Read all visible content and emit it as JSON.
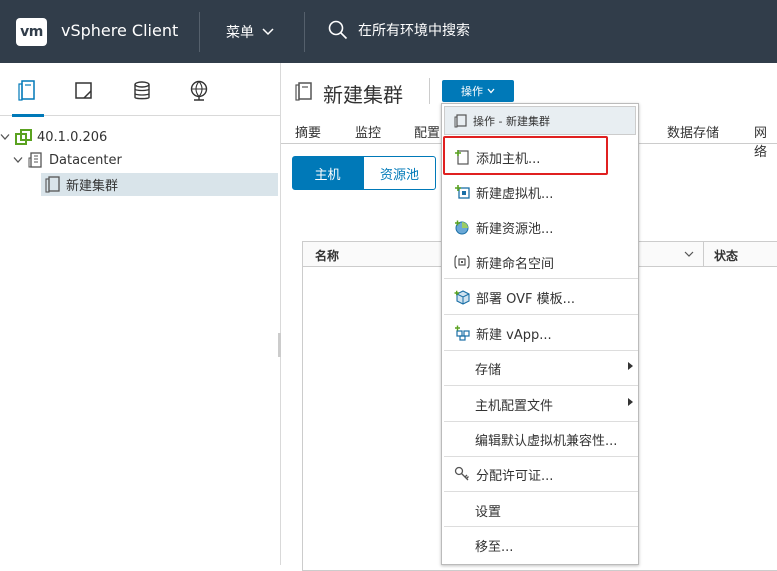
{
  "header": {
    "logo": "vm",
    "app_title": "vSphere Client",
    "menu_label": "菜单",
    "search_label": "在所有环境中搜索"
  },
  "left_tabs": [
    {
      "icon": "hosts-clusters-icon",
      "active": true
    },
    {
      "icon": "vms-templates-icon",
      "active": false
    },
    {
      "icon": "storage-icon",
      "active": false
    },
    {
      "icon": "networking-icon",
      "active": false
    }
  ],
  "tree": {
    "vcenter": "40.1.0.206",
    "datacenter": "Datacenter",
    "cluster": "新建集群"
  },
  "content": {
    "title": "新建集群",
    "actions_label": "操作",
    "tabs": [
      "摘要",
      "监控",
      "配置",
      "数据存储",
      "网络"
    ],
    "segments": [
      "主机",
      "资源池"
    ],
    "grid_columns": [
      "名称",
      "状态"
    ]
  },
  "dropdown": {
    "header": "操作 - 新建集群",
    "items": [
      {
        "label": "添加主机...",
        "icon": "add-host-icon"
      },
      {
        "label": "新建虚拟机...",
        "icon": "new-vm-icon"
      },
      {
        "label": "新建资源池...",
        "icon": "new-resource-pool-icon"
      },
      {
        "label": "新建命名空间",
        "icon": "new-namespace-icon"
      },
      {
        "label": "部署 OVF 模板...",
        "icon": "deploy-ovf-icon"
      },
      {
        "label": "新建 vApp...",
        "icon": "new-vapp-icon"
      },
      {
        "label": "存储",
        "icon": "",
        "submenu": true
      },
      {
        "label": "主机配置文件",
        "icon": "",
        "submenu": true
      },
      {
        "label": "编辑默认虚拟机兼容性...",
        "icon": ""
      },
      {
        "label": "分配许可证...",
        "icon": "license-icon"
      },
      {
        "label": "设置",
        "icon": ""
      },
      {
        "label": "移至...",
        "icon": ""
      }
    ]
  },
  "colors": {
    "header_bg": "#313d4a",
    "accent": "#0079b8",
    "highlight": "#e02020"
  }
}
